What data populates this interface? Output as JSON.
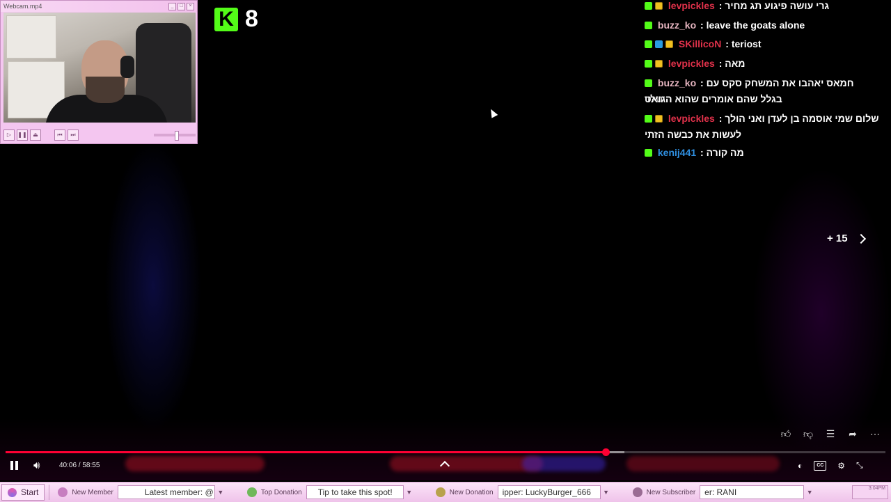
{
  "webcam": {
    "title": "Webcam.mp4",
    "controls": [
      "play-icon",
      "pause-icon",
      "eject-icon",
      "previous-icon",
      "next-icon"
    ]
  },
  "kick": {
    "count": "8",
    "logo": "K"
  },
  "chat": {
    "messages": [
      {
        "user": "levpickles",
        "color": "#e0314a",
        "badges": [
          "kick",
          "crown"
        ],
        "text": "גרי עושה פיגוע תג מחיר"
      },
      {
        "user": "buzz_ko",
        "color": "#e6b5c0",
        "badges": [
          "kick"
        ],
        "text": "leave the goats alone"
      },
      {
        "user": "SKillicoN",
        "color": "#e0314a",
        "badges": [
          "kick",
          "mod",
          "crown"
        ],
        "text": "teriost"
      },
      {
        "user": "levpickles",
        "color": "#e0314a",
        "badges": [
          "kick",
          "crown"
        ],
        "text": "מאה"
      },
      {
        "user": "buzz_ko",
        "color": "#e6b5c0",
        "badges": [
          "kick"
        ],
        "text": "חמאס יאהבו את המשחק סקס עם היטלר",
        "text2": "בגלל שהם אומרים שהוא הגואט"
      },
      {
        "user": "levpickles",
        "color": "#e0314a",
        "badges": [
          "kick",
          "crown"
        ],
        "text": "שלום שמי אוסמה בן לעדן ואני הולך",
        "text2": "לעשות את כבשה הזתי"
      },
      {
        "user": "kenij441",
        "color": "#2f8fe0",
        "badges": [
          "kick"
        ],
        "text": "מה קורה"
      }
    ]
  },
  "skip": {
    "label": "+ 15"
  },
  "player": {
    "time_current": "40:06",
    "time_total": "58:55",
    "time_display": "40:06 / 58:55",
    "progress": 0.682,
    "buffered": 0.703,
    "accent": "#ff0033",
    "cc_label": "CC",
    "actions": [
      "like-icon",
      "dislike-icon",
      "comment-icon",
      "share-icon",
      "more-icon"
    ]
  },
  "taskbar": {
    "start": "Start",
    "new_member": "New Member",
    "latest_member": "Latest member: @",
    "top_donation": "Top Donation",
    "top_donation_value": "Tip to take this spot!",
    "new_donation": "New Donation",
    "new_donation_value": "ipper: LuckyBurger_666",
    "new_subscriber": "New Subscriber",
    "new_subscriber_value": "er: RANI",
    "tray_time": "3:04PM"
  }
}
